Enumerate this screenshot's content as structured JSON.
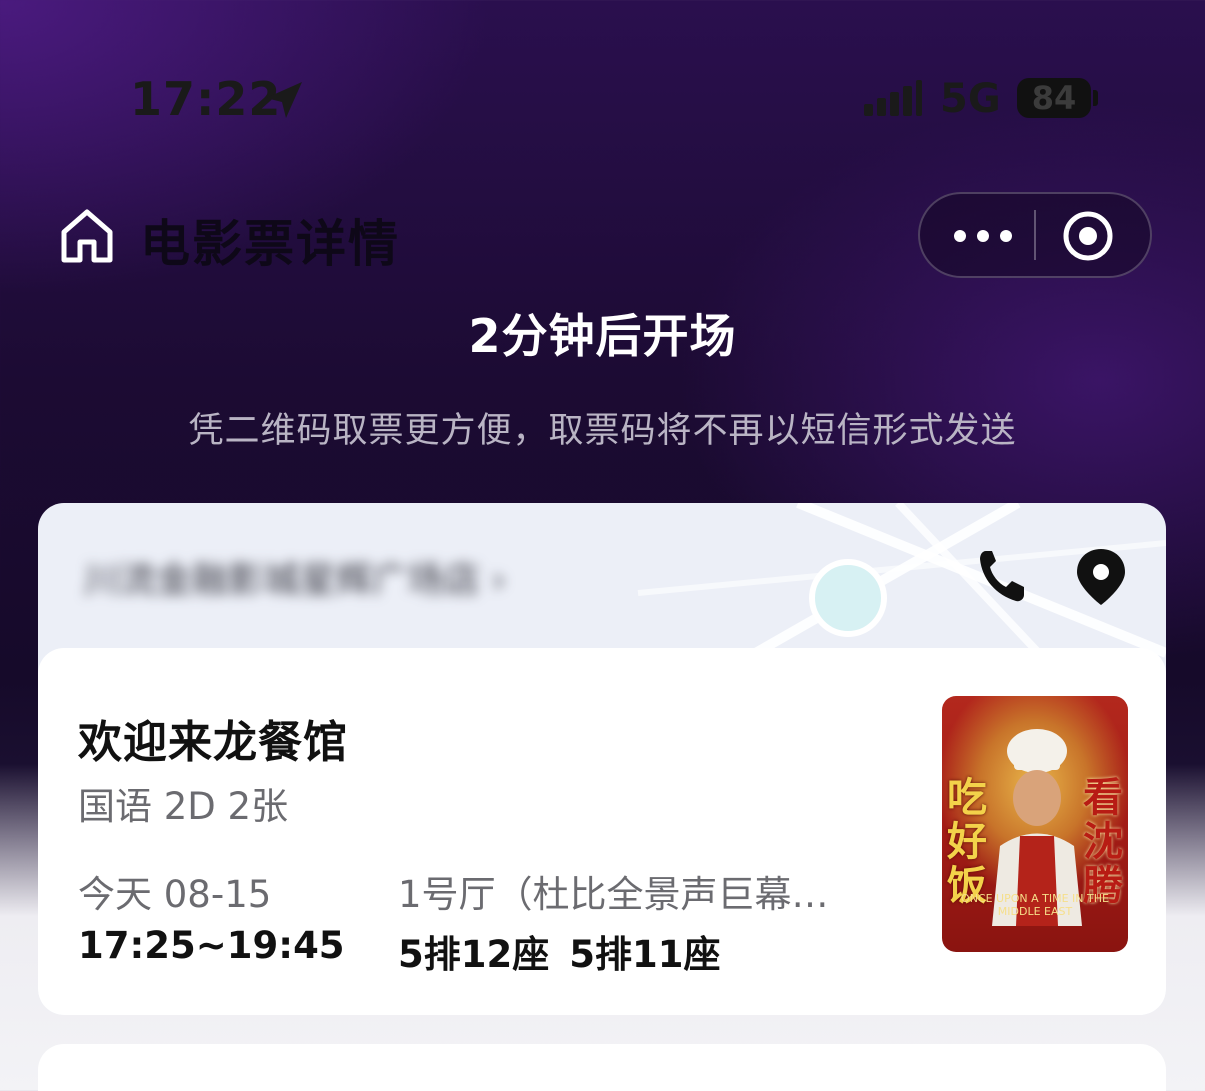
{
  "status_bar": {
    "time": "17:22",
    "network": "5G",
    "battery": "84",
    "icons": [
      "location-arrow-icon",
      "signal-icon"
    ]
  },
  "header": {
    "title": "电影票详情",
    "home_icon": "home-icon",
    "more_icon": "more-dots-icon",
    "close_icon": "target-close-icon"
  },
  "banner": {
    "countdown": "2分钟后开场",
    "notice": "凭二维码取票更方便，取票码将不再以短信形式发送"
  },
  "cinema": {
    "name": "川流金融影城星辉广场店 ›",
    "phone_icon": "phone-icon",
    "location_icon": "map-pin-icon"
  },
  "ticket": {
    "movie_title": "欢迎来龙餐馆",
    "meta": "国语 2D 2张",
    "date": "今天 08-15",
    "time": "17:25~19:45",
    "hall": "1号厅（杜比全景声巨幕…",
    "seats": [
      "5排12座",
      "5排11座"
    ],
    "poster": {
      "left_text": "吃好饭",
      "right_text": "看沈腾",
      "caption": "ONCE UPON A TIME IN THE MIDDLE EAST"
    }
  },
  "colors": {
    "header_gradient_top": "#2a0f4e",
    "header_gradient_bottom": "#160a2a",
    "page_background": "#f3f3f6",
    "card_background": "#ffffff",
    "poster_red": "#a31c16"
  }
}
